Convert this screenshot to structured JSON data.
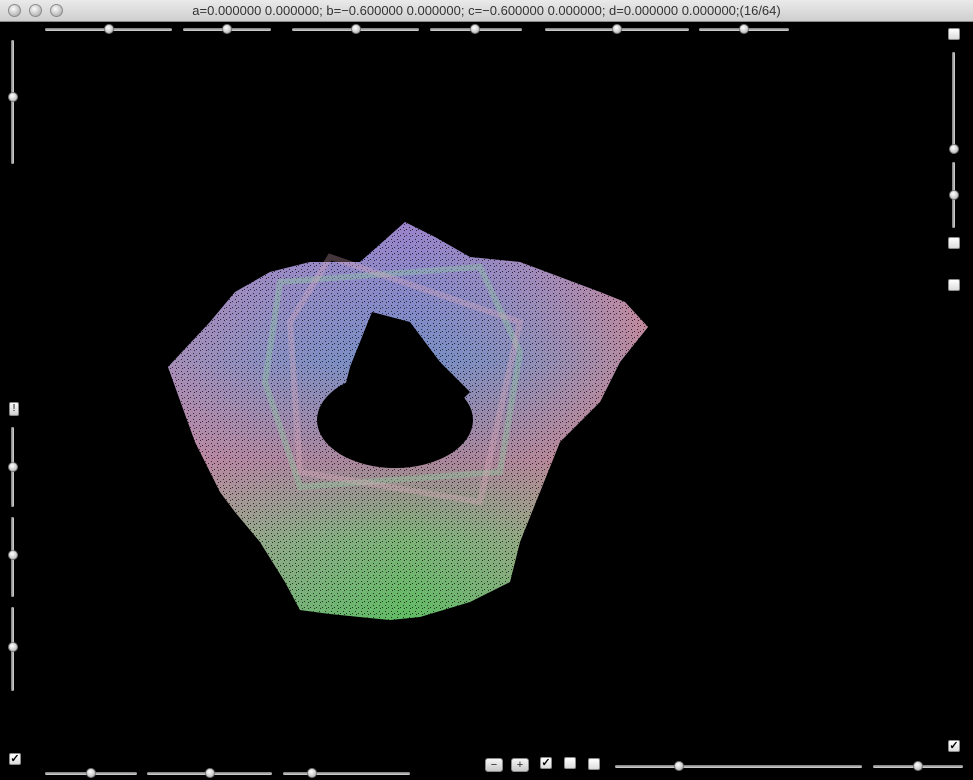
{
  "window": {
    "title": "a=0.000000 0.000000; b=−0.600000 0.000000; c=−0.600000 0.000000; d=0.000000 0.000000;(16/64)"
  },
  "controls": {
    "top_sliders": [
      0.5,
      0.5,
      0.47,
      0.5,
      0.5,
      0.5
    ],
    "left_sliders": [
      0.45,
      0.45,
      0.45,
      0.5
    ],
    "right_sliders": [
      0.95,
      0.5
    ],
    "bottom_left_sliders": [
      0.5,
      0.5,
      0.25
    ],
    "bottom_right_sliders": [
      0.27,
      0.58
    ],
    "checkboxes": {
      "top_right_1": false,
      "top_right_2": false,
      "top_right_3": false,
      "bottom_left": true,
      "bottom_mid_1": true,
      "bottom_mid_2": false,
      "bottom_mid_3": false,
      "bottom_right": true
    },
    "minus_label": "−",
    "plus_label": "+",
    "left_button_label": "!",
    "check_glyph": "✓"
  },
  "colors": {
    "background": "#000000",
    "fractal_top": "#9a6cd9",
    "fractal_center": "#6e8fe0",
    "fractal_right": "#e08a8a",
    "fractal_bottom": "#6fd957"
  }
}
